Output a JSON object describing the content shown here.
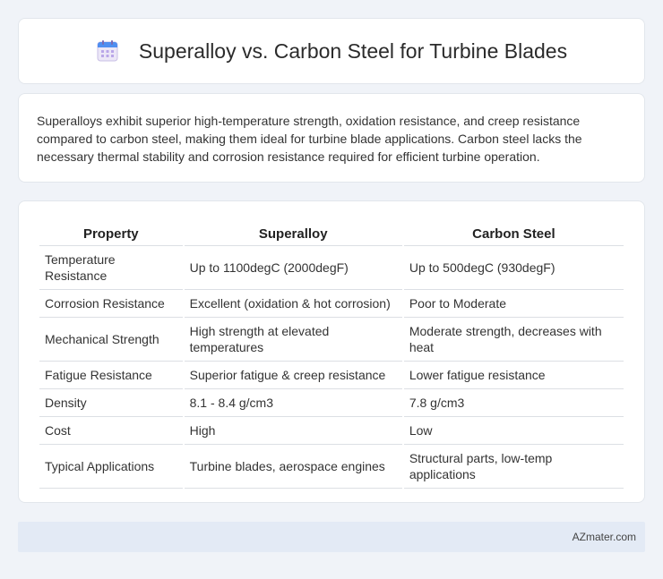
{
  "header": {
    "title": "Superalloy vs. Carbon Steel for Turbine Blades",
    "icon": "calendar-icon"
  },
  "summary": {
    "text": "Superalloys exhibit superior high-temperature strength, oxidation resistance, and creep resistance compared to carbon steel, making them ideal for turbine blade applications. Carbon steel lacks the necessary thermal stability and corrosion resistance required for efficient turbine operation."
  },
  "table": {
    "headers": [
      "Property",
      "Superalloy",
      "Carbon Steel"
    ],
    "rows": [
      [
        "Temperature Resistance",
        "Up to 1100degC (2000degF)",
        "Up to 500degC (930degF)"
      ],
      [
        "Corrosion Resistance",
        "Excellent (oxidation & hot corrosion)",
        "Poor to Moderate"
      ],
      [
        "Mechanical Strength",
        "High strength at elevated temperatures",
        "Moderate strength, decreases with heat"
      ],
      [
        "Fatigue Resistance",
        "Superior fatigue & creep resistance",
        "Lower fatigue resistance"
      ],
      [
        "Density",
        "8.1 - 8.4 g/cm3",
        "7.8 g/cm3"
      ],
      [
        "Cost",
        "High",
        "Low"
      ],
      [
        "Typical Applications",
        "Turbine blades, aerospace engines",
        "Structural parts, low-temp applications"
      ]
    ]
  },
  "footer": {
    "text": "AZmater.com"
  }
}
